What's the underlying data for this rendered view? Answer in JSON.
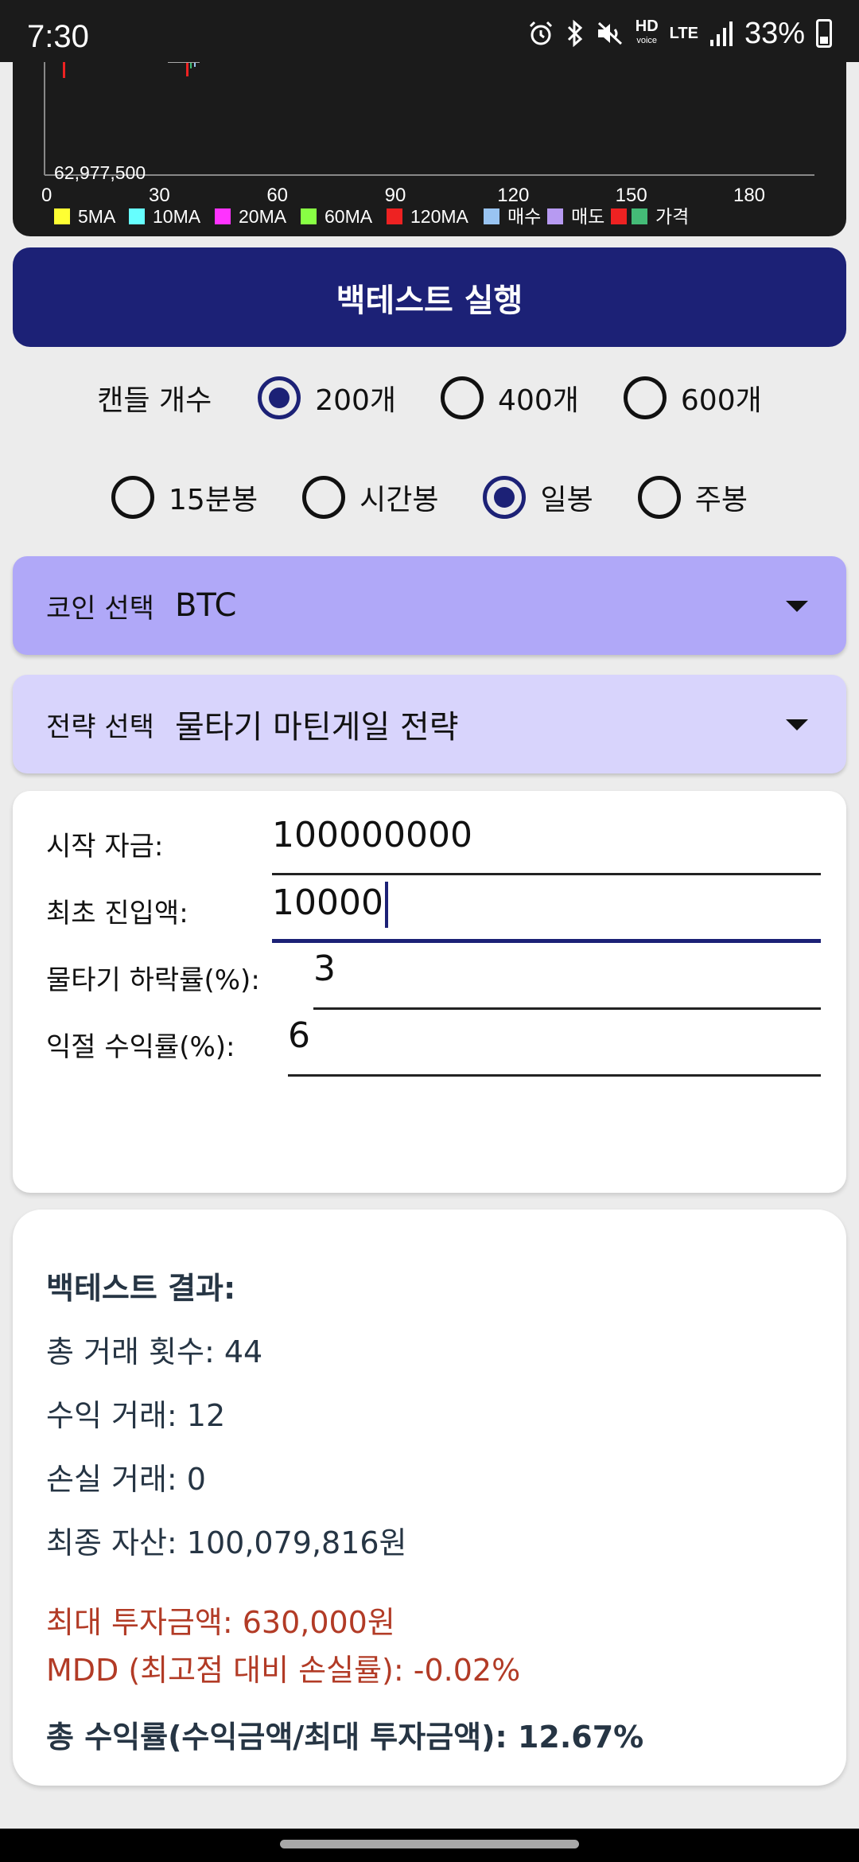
{
  "status_bar": {
    "time": "7:30",
    "battery": "33%",
    "hd_label": "HD",
    "hd_sub": "voice",
    "lte_label": "LTE",
    "icons": [
      "alarm-icon",
      "bluetooth-icon",
      "mute-icon",
      "hd-voice-icon",
      "lte-icon",
      "signal-icon",
      "battery-icon"
    ]
  },
  "chart": {
    "min_label": "62,977,500",
    "ticks": [
      "0",
      "30",
      "60",
      "90",
      "120",
      "150",
      "180"
    ],
    "legend": [
      {
        "label": "5MA",
        "color": "#ffff33"
      },
      {
        "label": "10MA",
        "color": "#66ffff"
      },
      {
        "label": "20MA",
        "color": "#ff33ff"
      },
      {
        "label": "60MA",
        "color": "#88ff44"
      },
      {
        "label": "120MA",
        "color": "#ee2222"
      },
      {
        "label": "매수",
        "color": "#99c4f2"
      },
      {
        "label": "매도",
        "color": "#b79af2"
      },
      {
        "label": "가격",
        "color": "#ee2222",
        "color2": "#44bb77"
      }
    ]
  },
  "run_button": {
    "label": "백테스트 실행"
  },
  "candles": {
    "label": "캔들 개수",
    "options": [
      "200개",
      "400개",
      "600개"
    ],
    "selected": 0
  },
  "interval": {
    "options": [
      "15분봉",
      "시간봉",
      "일봉",
      "주봉"
    ],
    "selected": 2
  },
  "coin": {
    "label": "코인 선택",
    "value": "BTC"
  },
  "strategy": {
    "label": "전략 선택",
    "value": "물타기 마틴게일 전략"
  },
  "inputs": {
    "start_capital": {
      "label": "시작 자금:",
      "value": "100000000"
    },
    "initial_entry": {
      "label": "최초 진입액:",
      "value": "10000"
    },
    "drop_rate": {
      "label": "물타기 하락률(%):",
      "value": "3"
    },
    "take_profit": {
      "label": "익절 수익률(%):",
      "value": "6"
    }
  },
  "results": {
    "title": "백테스트 결과:",
    "total_trades": "총 거래 횟수: 44",
    "win_trades": "수익 거래: 12",
    "loss_trades": "손실 거래: 0",
    "final_assets": "최종 자산: 100,079,816원",
    "max_invest": "최대 투자금액: 630,000원",
    "mdd": "MDD (최고점 대비 손실률): -0.02%",
    "total_return": "총 수익률(수익금액/최대 투자금액): 12.67%"
  }
}
